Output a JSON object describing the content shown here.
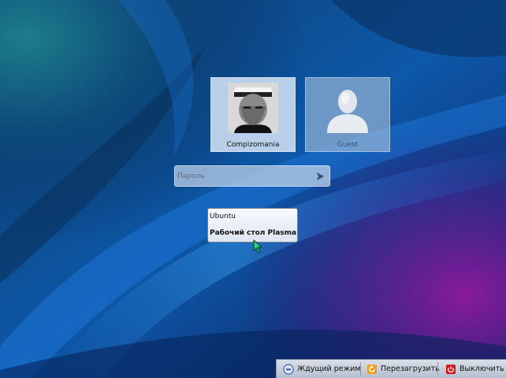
{
  "users": [
    {
      "name": "Compizomania",
      "selected": true,
      "avatar": "man-in-hat-portrait"
    },
    {
      "name": "Guest",
      "selected": false,
      "avatar": "guest-silhouette-icon"
    }
  ],
  "password": {
    "placeholder": "Пароль",
    "value": ""
  },
  "sessions": [
    {
      "label": "Ubuntu",
      "selected": false
    },
    {
      "label": "Рабочий стол Plasma",
      "selected": true
    }
  ],
  "power": {
    "suspend_label": "Ждущий режим",
    "restart_label": "Перезагрузить",
    "shutdown_label": "Выключить"
  },
  "colors": {
    "suspend_icon": "#3a5fa8",
    "restart_icon": "#f0a020",
    "shutdown_icon": "#d01818"
  }
}
